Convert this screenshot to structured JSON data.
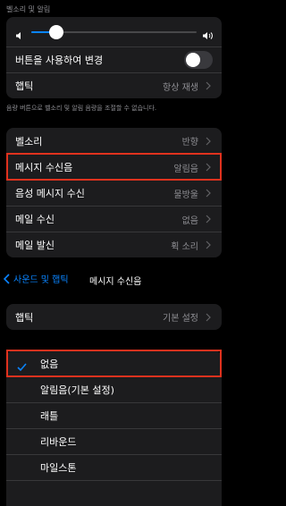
{
  "top_section": {
    "label": "벨소리 및 알림",
    "volume_level": 0.15,
    "change_with_buttons_label": "버튼을 사용하여 변경",
    "change_with_buttons_on": false,
    "haptics_label": "햅틱",
    "haptics_value": "항상 재생",
    "footer": "음량 버튼으로 벨소리 및 알림 음량을 조절할 수 없습니다."
  },
  "sounds": [
    {
      "label": "벨소리",
      "value": "반향"
    },
    {
      "label": "메시지 수신음",
      "value": "알림음"
    },
    {
      "label": "음성 메시지 수신",
      "value": "물방울"
    },
    {
      "label": "메일 수신",
      "value": "없음"
    },
    {
      "label": "메일 발신",
      "value": "휙 소리"
    }
  ],
  "nav": {
    "back_label": "사운드 및 햅틱",
    "title": "메시지 수신음"
  },
  "detail": {
    "haptics_label": "햅틱",
    "haptics_value": "기본 설정"
  },
  "tones": [
    {
      "label": "없음",
      "selected": true
    },
    {
      "label": "알림음(기본 설정)",
      "selected": false
    },
    {
      "label": "래틀",
      "selected": false
    },
    {
      "label": "리바운드",
      "selected": false
    },
    {
      "label": "마일스톤",
      "selected": false
    }
  ],
  "colors": {
    "highlight": "#e0321e",
    "accent": "#0a84ff"
  }
}
